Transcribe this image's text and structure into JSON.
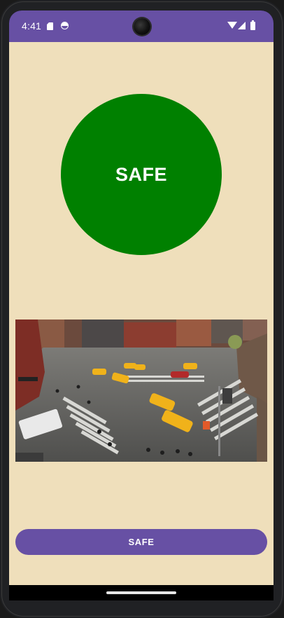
{
  "status_bar": {
    "time": "4:41",
    "icons": [
      "sd-card-icon",
      "face-icon",
      "camera-cutout",
      "wifi-icon",
      "signal-icon",
      "battery-icon"
    ],
    "background_color": "#6750a4"
  },
  "main": {
    "background_color": "#efdfbb",
    "status_circle": {
      "label": "SAFE",
      "color": "#008000"
    },
    "image": {
      "subject": "street-intersection-photo"
    },
    "action_button": {
      "label": "SAFE",
      "color": "#6750a4"
    }
  },
  "navigation": {
    "handle": "home-gesture-handle"
  }
}
